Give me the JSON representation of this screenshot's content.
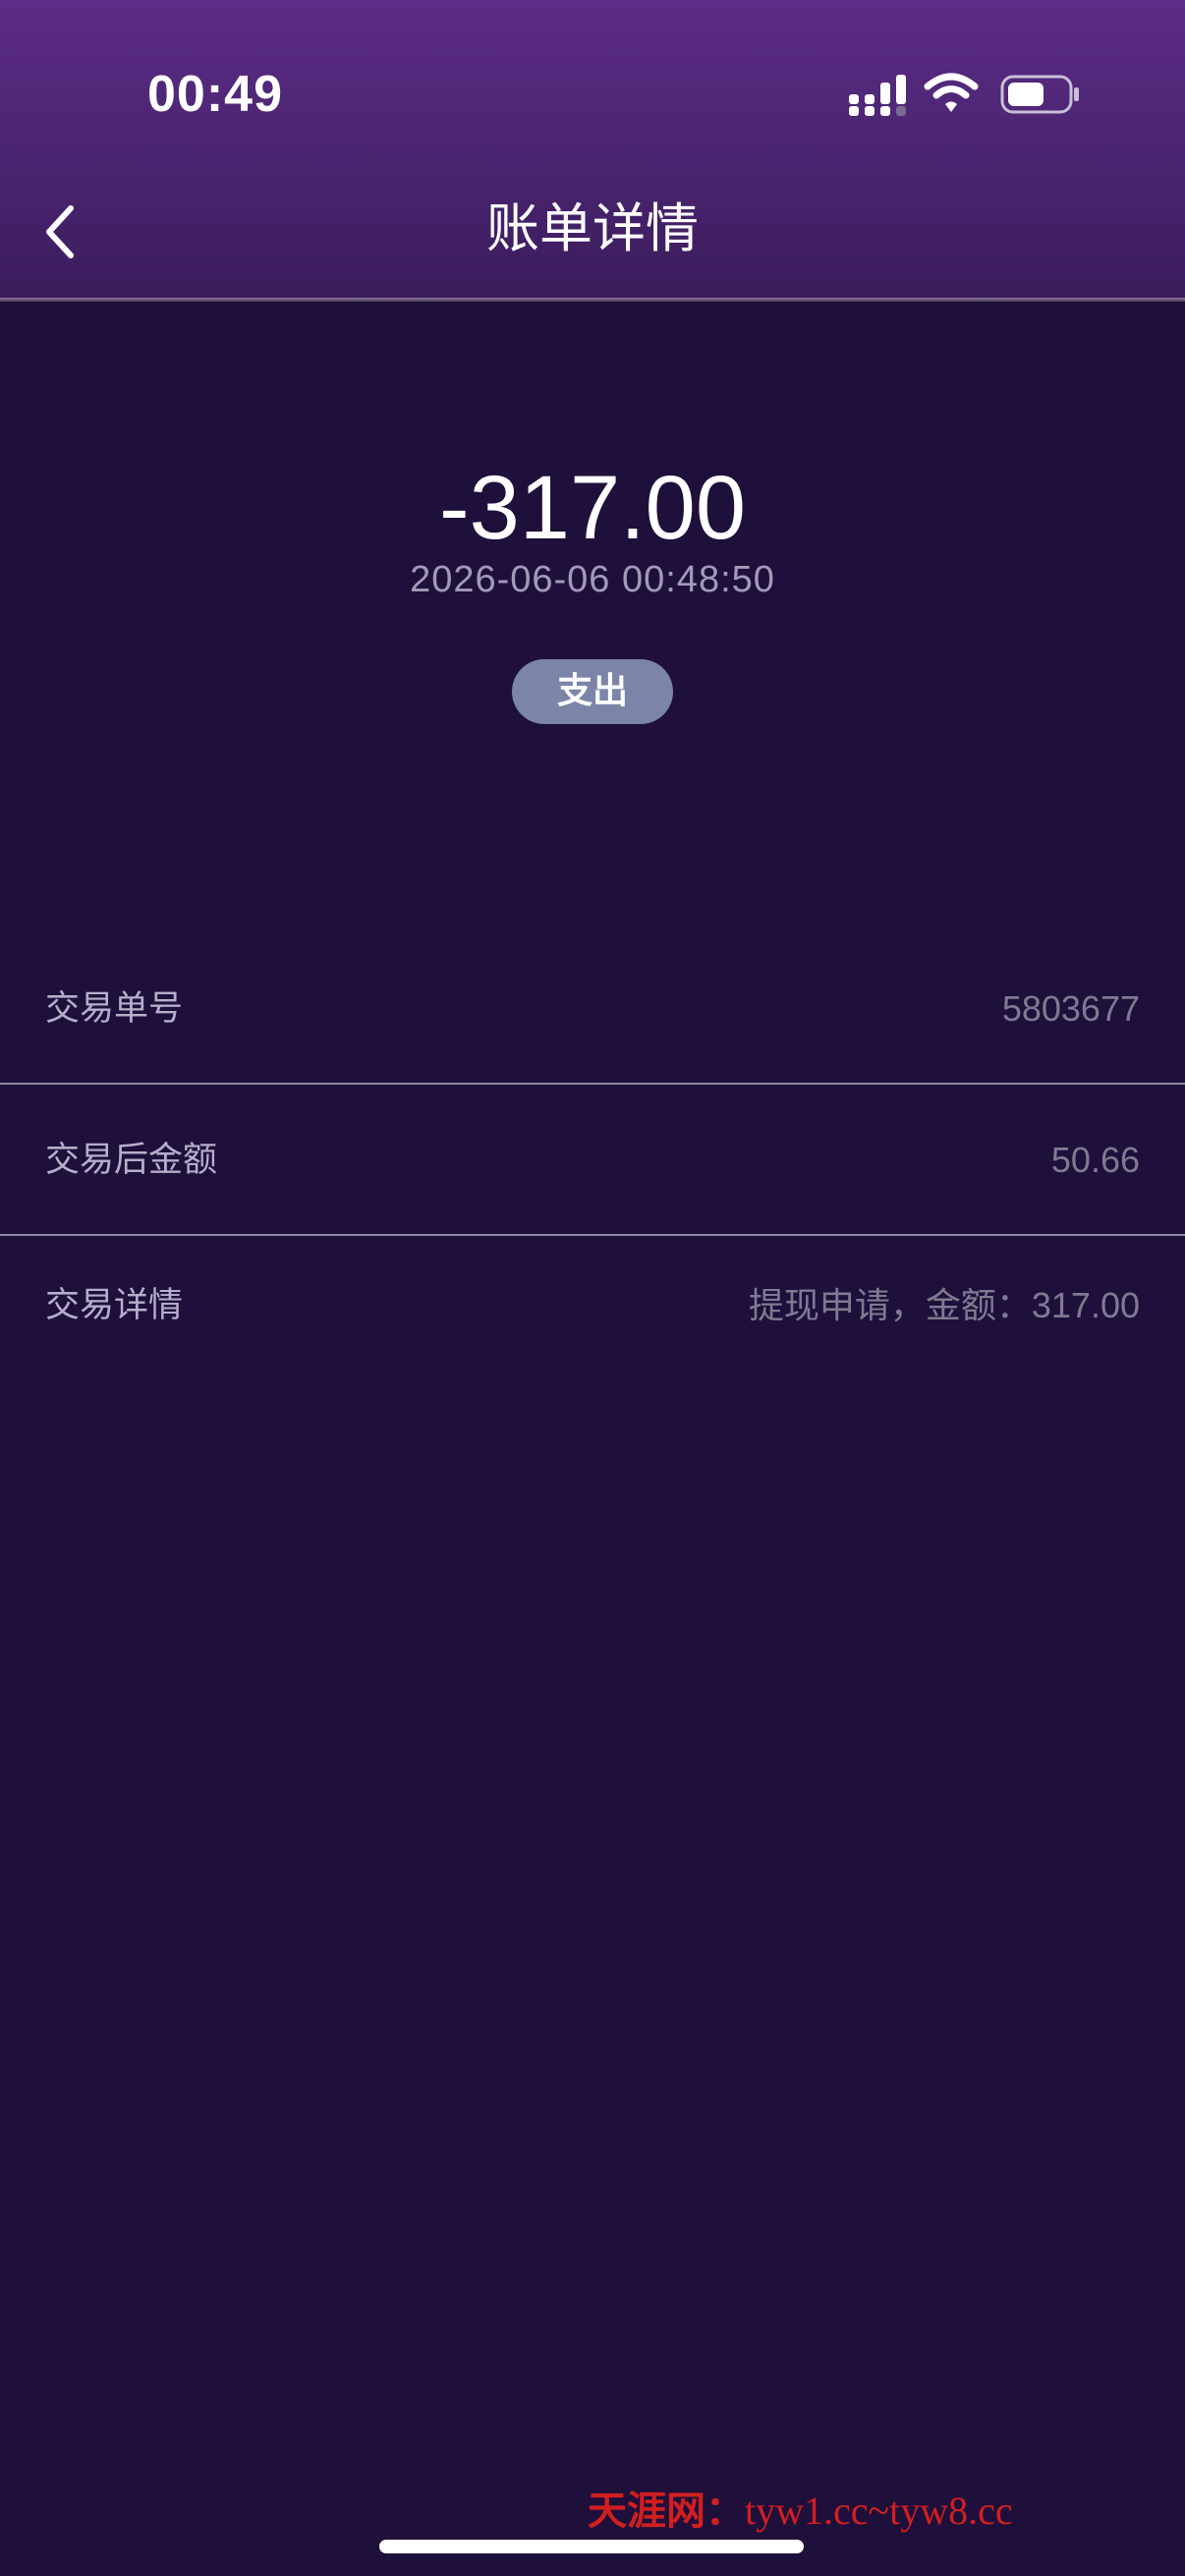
{
  "status_bar": {
    "time": "00:49",
    "signal_icon": "signal-icon",
    "wifi_icon": "wifi-icon",
    "battery_icon": "battery-icon"
  },
  "nav": {
    "back_icon": "chevron-left-icon",
    "title": "账单详情"
  },
  "summary": {
    "amount": "-317.00",
    "datetime": "2026-06-06 00:48:50",
    "type_badge": "支出"
  },
  "details": [
    {
      "label": "交易单号",
      "value": "5803677"
    },
    {
      "label": "交易后金额",
      "value": "50.66"
    },
    {
      "label": "交易详情",
      "value": "提现申请，金额：317.00"
    }
  ],
  "watermark": {
    "brand": "天涯网：",
    "text": "tyw1.cc~tyw8.cc"
  },
  "colors": {
    "background": "#1f0f3b",
    "header_top": "#5c2c86",
    "badge": "#7c85a7",
    "label_text": "#b6aeca",
    "value_text": "#7f7a91",
    "watermark": "#d21f1f"
  }
}
